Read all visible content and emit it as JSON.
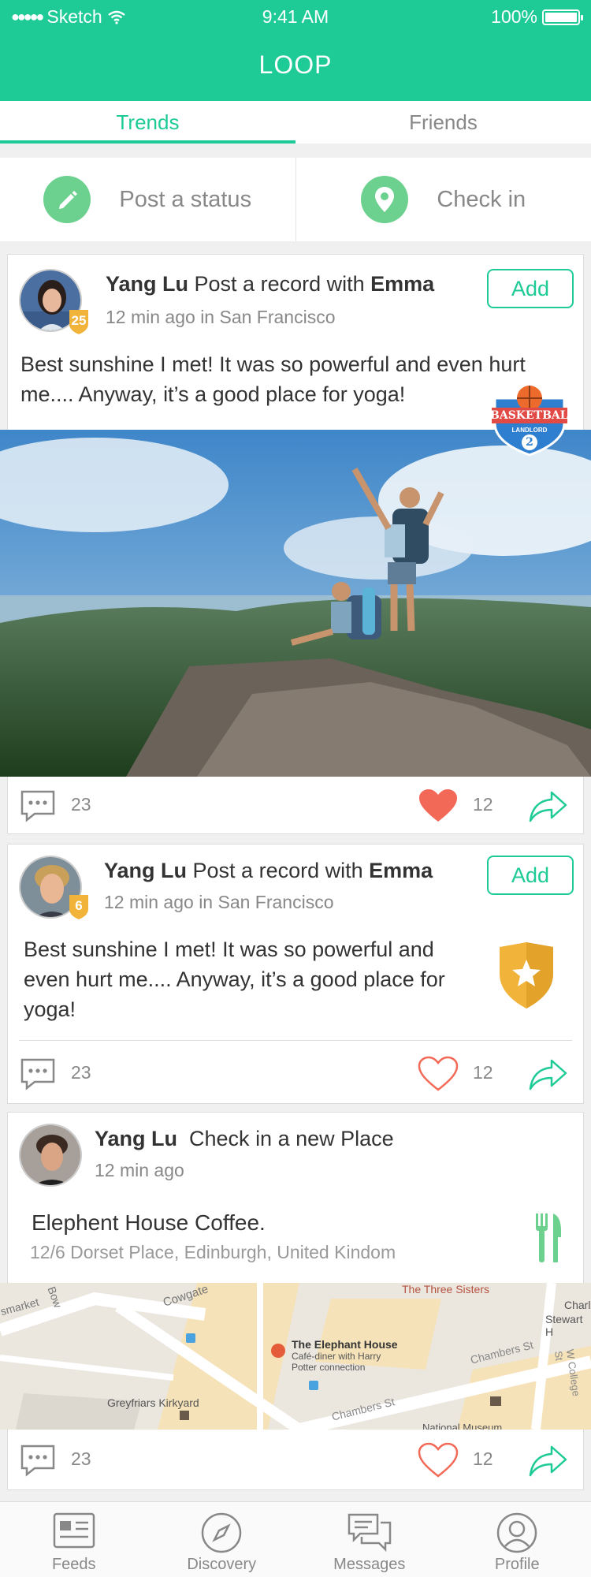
{
  "status_bar": {
    "carrier": "Sketch",
    "time": "9:41 AM",
    "battery": "100%"
  },
  "app": {
    "title": "LOOP"
  },
  "tabs": [
    {
      "label": "Trends",
      "active": true
    },
    {
      "label": "Friends",
      "active": false
    }
  ],
  "actions": {
    "post_status": "Post a status",
    "check_in": "Check in"
  },
  "posts": [
    {
      "name": "Yang Lu",
      "action": "Post a record with",
      "with": "Emma",
      "level": "25",
      "meta": "12 min ago in San Francisco",
      "add_label": "Add",
      "text": "Best sunshine I met! It was so powerful and even hurt me.... Anyway, it’s a good place for yoga!",
      "badge": {
        "title": "BASKETBALL",
        "sub": "LANDLORD",
        "num": "2"
      },
      "comments": "23",
      "likes": "12",
      "liked": true
    },
    {
      "name": "Yang Lu",
      "action": "Post a record with",
      "with": "Emma",
      "level": "6",
      "meta": "12 min ago in San Francisco",
      "add_label": "Add",
      "text": "Best sunshine I met! It was so powerful and even hurt me.... Anyway, it’s a good place for yoga!",
      "comments": "23",
      "likes": "12",
      "liked": false
    },
    {
      "name": "Yang Lu",
      "action": "Check in a new Place",
      "meta": "12 min ago",
      "place_name": "Elephent House Coffee.",
      "place_address": "12/6 Dorset Place, Edinburgh, United Kindom",
      "map": {
        "labels": [
          "Cowgate",
          "Bow",
          "smarket",
          "The Three Sisters",
          "Charl",
          "Stewart H",
          "The Elephant House",
          "Café-diner with Harry",
          "Potter connection",
          "Chambers St",
          "Chambers St",
          "W College St",
          "Greyfriars Kirkyard",
          "National Museum"
        ]
      },
      "comments": "23",
      "likes": "12",
      "liked": false
    }
  ],
  "tabbar": [
    {
      "label": "Feeds",
      "icon": "feeds-icon"
    },
    {
      "label": "Discovery",
      "icon": "compass-icon"
    },
    {
      "label": "Messages",
      "icon": "messages-icon"
    },
    {
      "label": "Profile",
      "icon": "profile-icon"
    }
  ],
  "colors": {
    "primary": "#1ecb96",
    "icon_green": "#6cd08e",
    "heart": "#f26a57"
  }
}
